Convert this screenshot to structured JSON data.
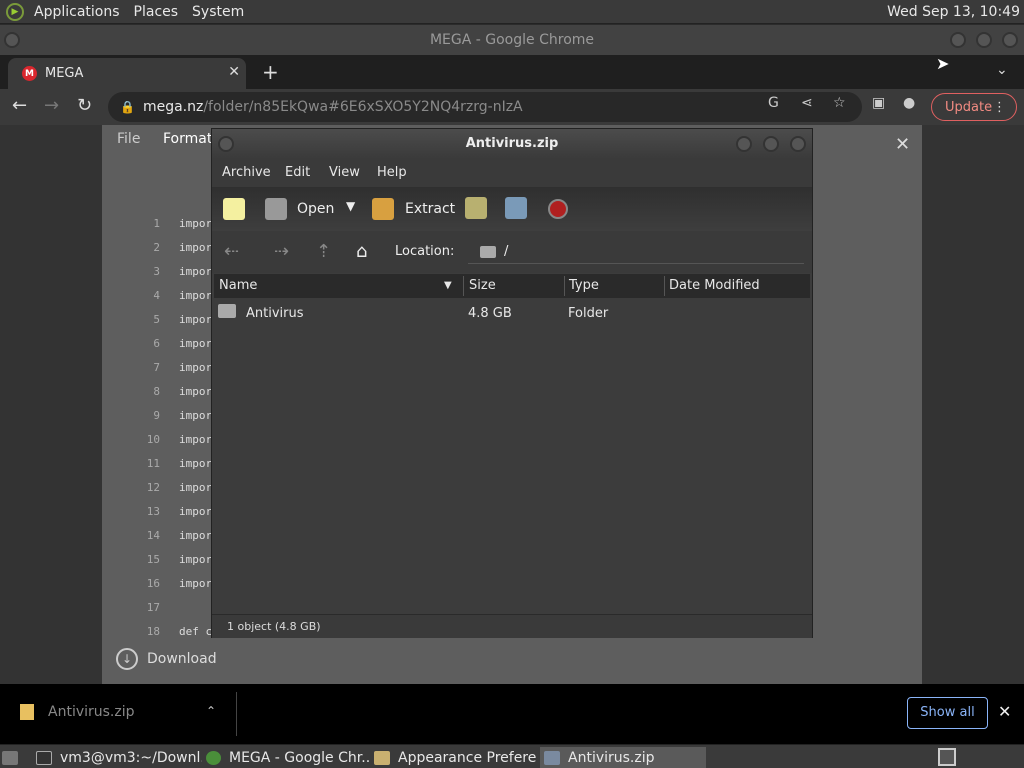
{
  "top_panel": {
    "menus": [
      "Applications",
      "Places",
      "System"
    ],
    "clock": "Wed Sep 13, 10:49"
  },
  "chrome": {
    "window_title": "MEGA - Google Chrome",
    "tab": {
      "label": "MEGA",
      "favicon_letter": "M"
    },
    "url_host": "mega.nz",
    "url_path": "/folder/n85EkQwa#6E6xSXO5Y2NQ4rzrg-nIzA",
    "update_label": "Update"
  },
  "page": {
    "menu": [
      "File",
      "Format"
    ],
    "line_numbers": [
      "1",
      "2",
      "3",
      "4",
      "5",
      "6",
      "7",
      "8",
      "9",
      "10",
      "11",
      "12",
      "13",
      "14",
      "15",
      "16",
      "17",
      "18"
    ],
    "code_lines": [
      "impor",
      "impor",
      "impor",
      "impor",
      "impor",
      "impor",
      "impor",
      "impor",
      "impor",
      "impor",
      "impor",
      "impor",
      "impor",
      "impor",
      "impor",
      "impor",
      "",
      "def c"
    ],
    "download_label": "Download"
  },
  "archive": {
    "title": "Antivirus.zip",
    "menu": [
      "Archive",
      "Edit",
      "View",
      "Help"
    ],
    "toolbar": {
      "open": "Open",
      "extract": "Extract"
    },
    "location_label": "Location:",
    "location_path": "/",
    "columns": [
      "Name",
      "Size",
      "Type",
      "Date Modified"
    ],
    "rows": [
      {
        "name": "Antivirus",
        "size": "4.8 GB",
        "type": "Folder",
        "modified": ""
      }
    ],
    "status": "1 object (4.8 GB)"
  },
  "shelf": {
    "file": "Antivirus.zip",
    "show_all": "Show all"
  },
  "taskbar": {
    "items": [
      "vm3@vm3:~/Downl...",
      "MEGA - Google Chr...",
      "Appearance Prefere...",
      "Antivirus.zip"
    ]
  },
  "colors": {
    "mega_red": "#d9272e",
    "update_red": "#f28b82",
    "link_blue": "#8ab4f8"
  }
}
